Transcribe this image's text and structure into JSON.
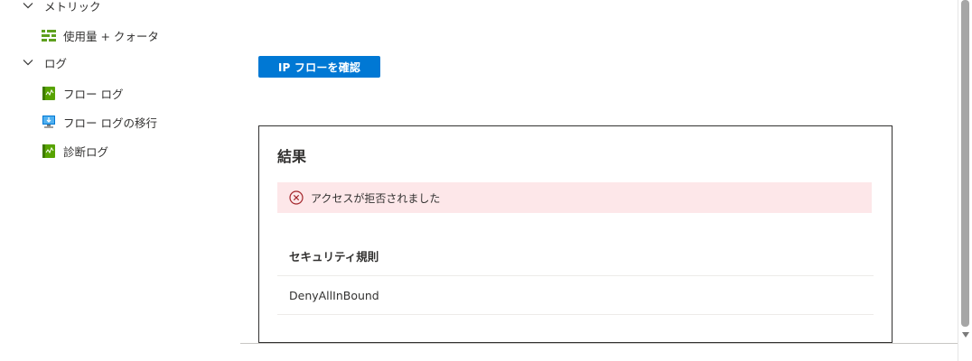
{
  "nav": {
    "metrics_group": {
      "label": "メトリック",
      "icon": "chevron-down-icon"
    },
    "usage_item": {
      "label": "使用量 + クォータ",
      "icon": "usage-bars-icon"
    },
    "logs_group": {
      "label": "ログ",
      "icon": "chevron-down-icon"
    },
    "flow_log_item": {
      "label": "フロー ログ",
      "icon": "flow-log-icon"
    },
    "flow_log_migration_item": {
      "label": "フロー ログの移行",
      "icon": "monitor-migrate-icon"
    },
    "diagnostic_log_item": {
      "label": "診断ログ",
      "icon": "diagnostic-log-icon"
    }
  },
  "main": {
    "check_button_label": "IP フローを確認",
    "result": {
      "title": "結果",
      "alert_text": "アクセスが拒否されました",
      "alert_icon": "error-circle-icon",
      "table": {
        "header": "セキュリティ規則",
        "rows": [
          "DenyAllInBound"
        ]
      }
    }
  },
  "colors": {
    "primary": "#0078d4",
    "error_bg": "#fde7e9",
    "error_icon": "#a4262c"
  }
}
